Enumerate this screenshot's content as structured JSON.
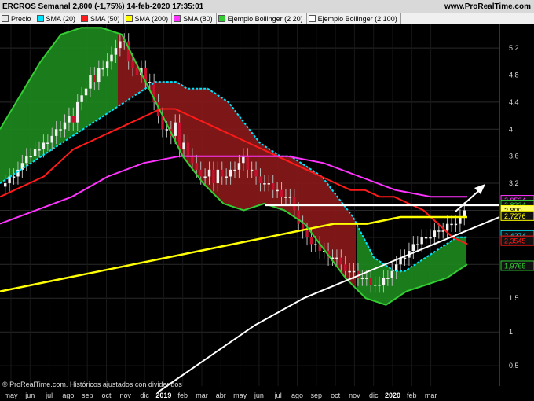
{
  "header": {
    "title": "ERCROS Semanal 2,800 (-1,75%) 14-feb-2020 17:35:01",
    "site": "www.ProRealTime.com"
  },
  "legend": [
    {
      "label": "Precio",
      "color": "#e8e8e8",
      "icon": "candlestick-icon"
    },
    {
      "label": "SMA (20)",
      "color": "#00e5ff"
    },
    {
      "label": "SMA (50)",
      "color": "#ff1a1a"
    },
    {
      "label": "SMA (200)",
      "color": "#ffff00"
    },
    {
      "label": "SMA (80)",
      "color": "#ff33ff"
    },
    {
      "label": "Ejemplo Bollinger (2 20)",
      "color": "#33cc33"
    },
    {
      "label": "Ejemplo Bollinger (2 100)",
      "color": "#ffffff"
    }
  ],
  "credit": "© ProRealTime.com. Históricos ajustados con dividendos",
  "colors": {
    "background": "#000000",
    "grid": "#2a2a2a",
    "axis_text": "#dddddd",
    "bull_fill": "#1d8a1d",
    "bear_fill": "#8b1a1a",
    "cyan": "#00e5ff",
    "red": "#ff1a1a",
    "yellow": "#ffff00",
    "magenta": "#ff33ff",
    "green": "#33cc33",
    "white": "#ffffff"
  },
  "chart_data": {
    "type": "candlestick",
    "x_axis": {
      "ticks": [
        "may",
        "jun",
        "jul",
        "ago",
        "sep",
        "oct",
        "nov",
        "dic",
        "2019",
        "feb",
        "mar",
        "abr",
        "may",
        "jun",
        "jul",
        "ago",
        "sep",
        "oct",
        "nov",
        "dic",
        "2020",
        "feb",
        "mar"
      ],
      "bold": [
        "2019",
        "2020"
      ]
    },
    "y_axis": {
      "ticks": [
        "0,5",
        "1",
        "1,5",
        "2",
        "2,4",
        "2,8",
        "3,2",
        "3,6",
        "4",
        "4,4",
        "4,8",
        "5,2"
      ],
      "ylim": [
        0.2,
        5.55
      ],
      "grid": true
    },
    "price_labels": [
      {
        "text": "2,9534",
        "value": 2.95,
        "color": "#ff33ff"
      },
      {
        "text": "2,8224",
        "value": 2.88,
        "color": "#33cc33"
      },
      {
        "text": "2,800",
        "value": 2.8,
        "color": "#ffff00",
        "highlight": true
      },
      {
        "text": "2,7276",
        "value": 2.72,
        "color": "#ffff00"
      },
      {
        "text": "2,4274",
        "value": 2.43,
        "color": "#00e5ff"
      },
      {
        "text": "2,3545",
        "value": 2.35,
        "color": "#ff1a1a"
      },
      {
        "text": "1,9765",
        "value": 1.98,
        "color": "#33cc33"
      }
    ],
    "last_price": 2.8,
    "candles": {
      "description": "weekly ERCROS price, 14-feb-2020 close 2,800",
      "closes": [
        3.2,
        3.3,
        3.3,
        3.4,
        3.5,
        3.6,
        3.6,
        3.7,
        3.7,
        3.8,
        3.8,
        3.9,
        4.0,
        4.0,
        4.1,
        4.2,
        4.1,
        4.4,
        4.5,
        4.6,
        4.8,
        4.7,
        4.9,
        4.9,
        5.0,
        5.1,
        5.2,
        5.3,
        5.3,
        5.0,
        4.9,
        4.8,
        4.9,
        4.7,
        4.7,
        4.4,
        4.2,
        4.0,
        4.0,
        3.9,
        4.1,
        3.7,
        3.8,
        3.6,
        3.5,
        3.4,
        3.3,
        3.3,
        3.4,
        3.2,
        3.4,
        3.3,
        3.3,
        3.4,
        3.4,
        3.5,
        3.6,
        3.4,
        3.4,
        3.3,
        3.2,
        3.2,
        3.2,
        3.1,
        3.1,
        3.0,
        3.0,
        3.0,
        2.8,
        2.6,
        2.5,
        2.4,
        2.3,
        2.3,
        2.2,
        2.2,
        2.1,
        2.1,
        2.1,
        2.0,
        1.9,
        1.9,
        1.9,
        1.8,
        1.8,
        1.8,
        1.7,
        1.7,
        1.7,
        1.8,
        1.8,
        1.9,
        2.0,
        2.1,
        2.1,
        2.2,
        2.3,
        2.3,
        2.4,
        2.4,
        2.4,
        2.5,
        2.5,
        2.5,
        2.6,
        2.6,
        2.6,
        2.7,
        2.8
      ]
    },
    "series": [
      {
        "name": "SMA (20)",
        "color": "#00e5ff",
        "values": [
          3.2,
          3.3,
          3.4,
          3.5,
          3.6,
          3.7,
          3.8,
          3.9,
          4.0,
          4.1,
          4.2,
          4.3,
          4.4,
          4.5,
          4.6,
          4.7,
          4.7,
          4.7,
          4.6,
          4.6,
          4.6,
          4.5,
          4.4,
          4.2,
          4.0,
          3.8,
          3.7,
          3.6,
          3.6,
          3.5,
          3.4,
          3.3,
          3.1,
          2.9,
          2.7,
          2.4,
          2.1,
          2.0,
          1.9,
          1.9,
          2.0,
          2.1,
          2.2,
          2.3,
          2.4,
          2.4
        ]
      },
      {
        "name": "SMA (50)",
        "color": "#ff1a1a",
        "values": [
          3.0,
          3.1,
          3.2,
          3.3,
          3.5,
          3.7,
          3.8,
          3.9,
          4.0,
          4.1,
          4.2,
          4.3,
          4.3,
          4.2,
          4.1,
          4.0,
          3.9,
          3.8,
          3.7,
          3.6,
          3.5,
          3.4,
          3.3,
          3.2,
          3.1,
          3.1,
          3.0,
          3.0,
          2.9,
          2.8,
          2.6,
          2.4,
          2.3
        ]
      },
      {
        "name": "SMA (200)",
        "color": "#ffff00",
        "values": [
          1.6,
          1.7,
          1.8,
          1.9,
          2.0,
          2.1,
          2.2,
          2.3,
          2.4,
          2.5,
          2.6,
          2.6,
          2.7,
          2.7,
          2.7
        ]
      },
      {
        "name": "SMA (80)",
        "color": "#ff33ff",
        "values": [
          2.6,
          2.8,
          3.0,
          3.3,
          3.5,
          3.6,
          3.6,
          3.6,
          3.6,
          3.5,
          3.3,
          3.1,
          3.0,
          3.0
        ]
      },
      {
        "name": "Ejemplo Bollinger (2 20)",
        "color": "#33cc33",
        "values": [
          4.0,
          4.5,
          5.0,
          5.4,
          5.5,
          5.5,
          5.4,
          4.8,
          4.2,
          3.6,
          3.2,
          2.9,
          2.8,
          2.9,
          2.8,
          2.6,
          2.2,
          1.8,
          1.5,
          1.4,
          1.6,
          1.7,
          1.8,
          2.0
        ]
      },
      {
        "name": "Ejemplo Bollinger (2 100)",
        "color": "#ffffff",
        "values": [
          0.1,
          0.6,
          1.1,
          1.5,
          1.8,
          2.1,
          2.4,
          2.7
        ]
      }
    ],
    "annotations": [
      {
        "type": "horizontal-line",
        "value": 2.8
      },
      {
        "type": "trendline",
        "color": "#ffffff"
      },
      {
        "type": "arrow",
        "direction": "up"
      }
    ]
  }
}
